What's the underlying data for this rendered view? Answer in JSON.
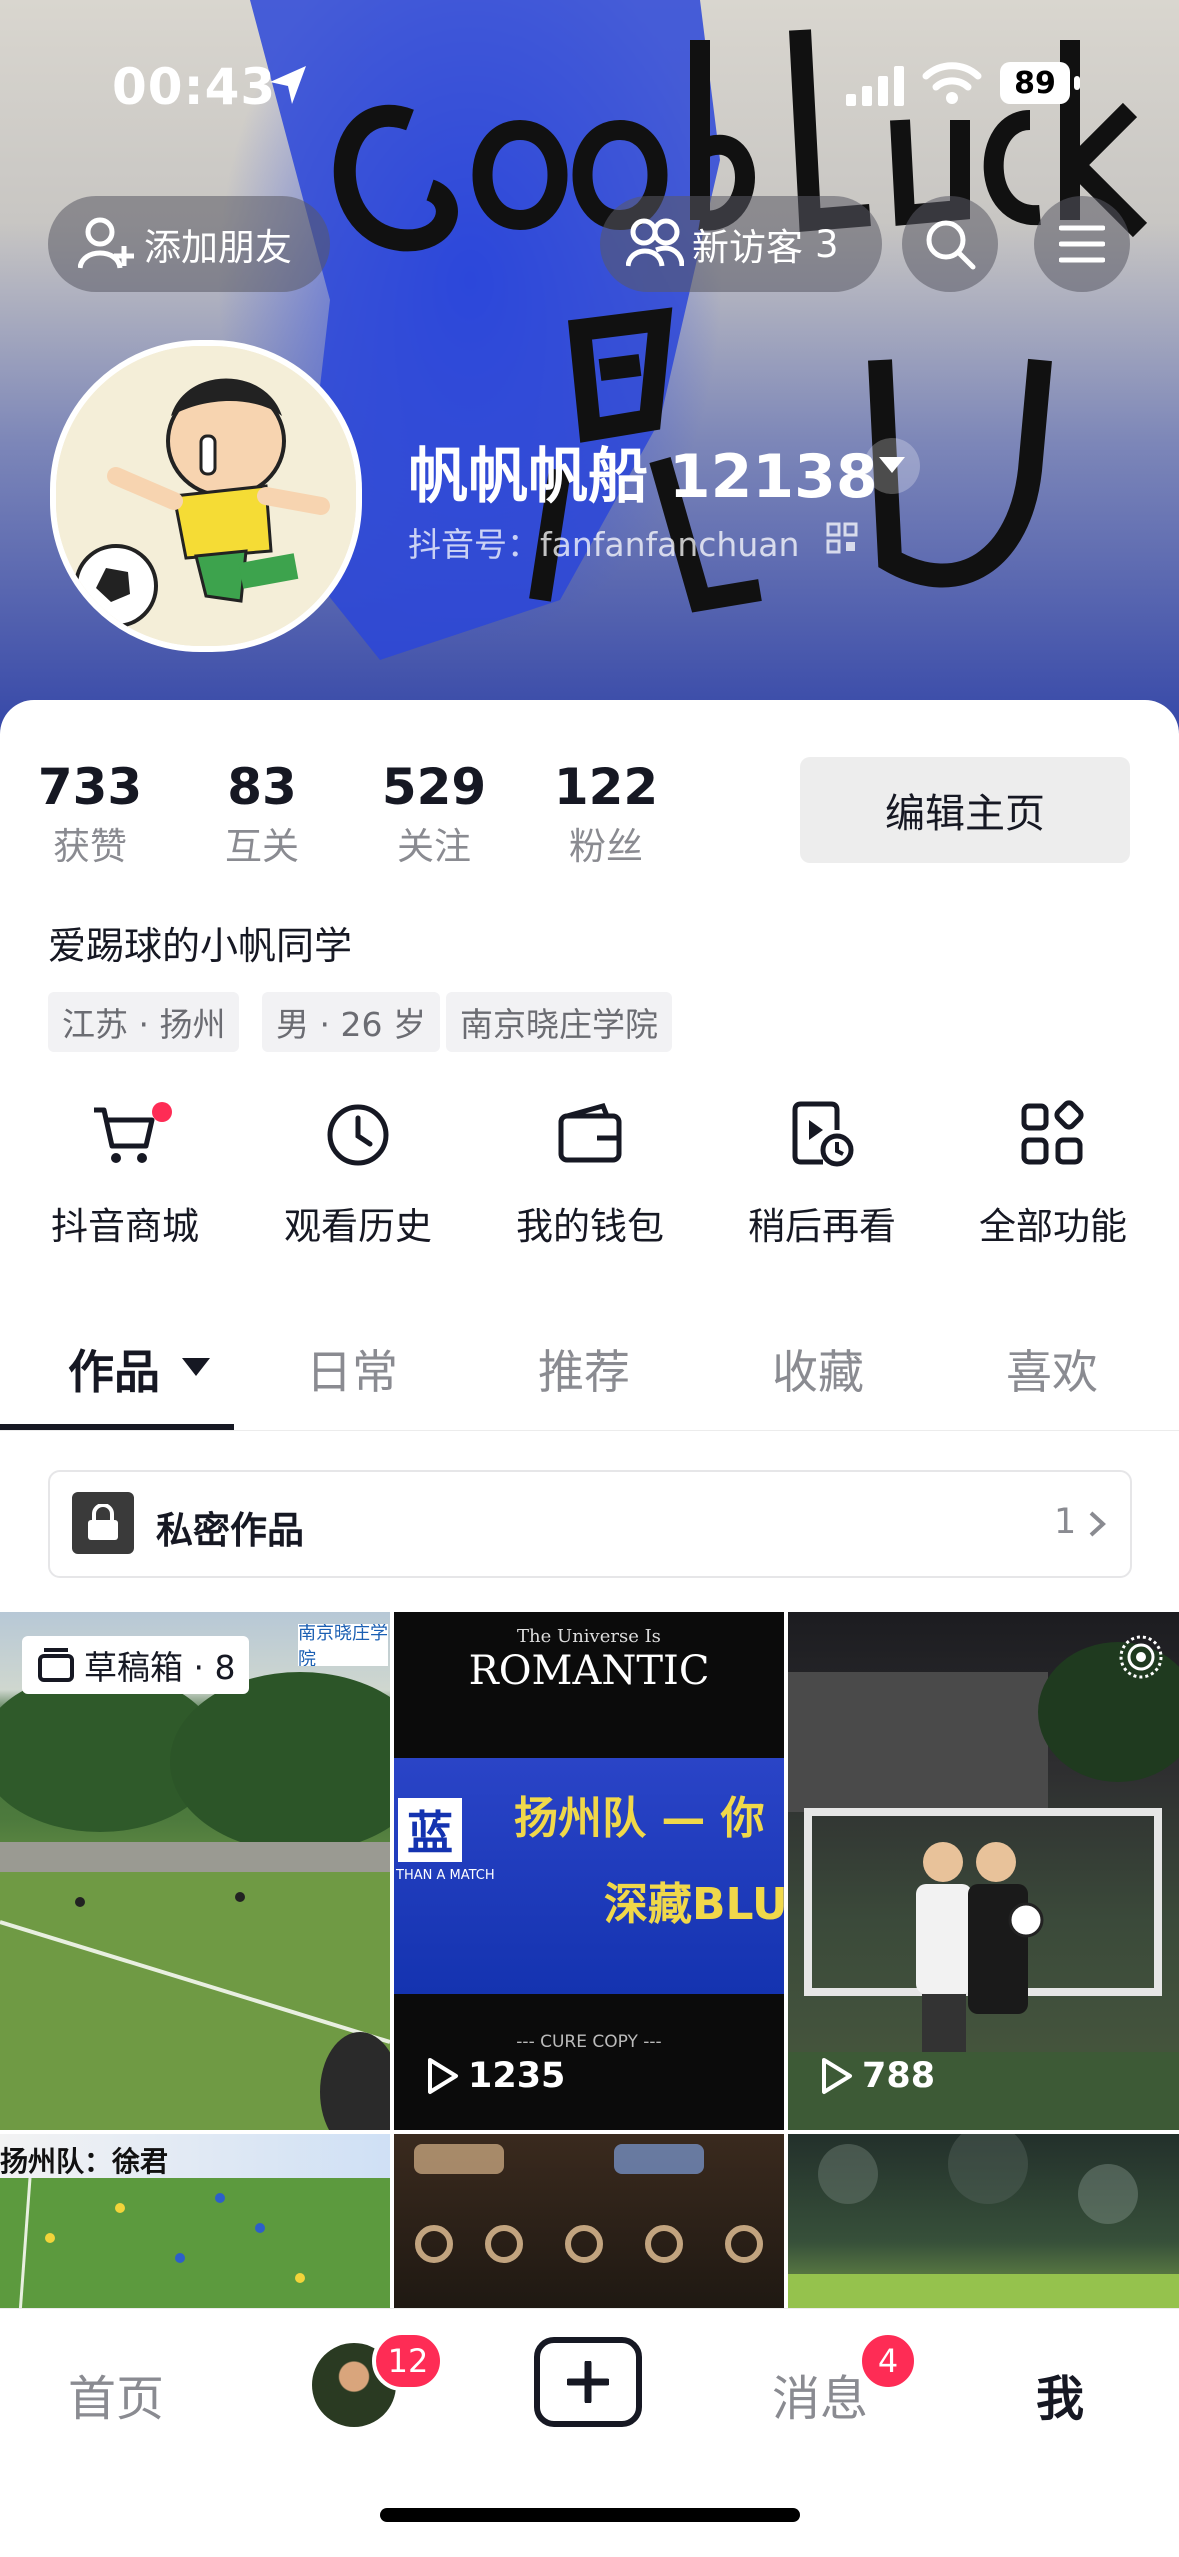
{
  "status_bar": {
    "time": "00:43",
    "battery": "89"
  },
  "header": {
    "add_friend_label": "添加朋友",
    "new_visitors_label": "新访客",
    "new_visitors_count": "3",
    "background_text": "Good Luck"
  },
  "profile": {
    "nickname": "帆帆帆船 12138",
    "douyin_id": "抖音号：fanfanfanchuan",
    "stats": [
      {
        "value": "733",
        "label": "获赞"
      },
      {
        "value": "83",
        "label": "互关"
      },
      {
        "value": "529",
        "label": "关注"
      },
      {
        "value": "122",
        "label": "粉丝"
      }
    ],
    "edit_button": "编辑主页",
    "bio": "爱踢球的小帆同学",
    "tags": [
      "江苏 · 扬州",
      "男 · 26 岁",
      "南京晓庄学院"
    ]
  },
  "functions": [
    {
      "label": "抖音商城",
      "icon": "cart-icon",
      "has_dot": true
    },
    {
      "label": "观看历史",
      "icon": "clock-icon"
    },
    {
      "label": "我的钱包",
      "icon": "wallet-icon"
    },
    {
      "label": "稍后再看",
      "icon": "watch-later-icon"
    },
    {
      "label": "全部功能",
      "icon": "grid-icon"
    }
  ],
  "tabs": [
    "作品",
    "日常",
    "推荐",
    "收藏",
    "喜欢"
  ],
  "active_tab": "作品",
  "private_works": {
    "label": "私密作品",
    "count": "1"
  },
  "videos": [
    {
      "badge": "草稿箱 · 8",
      "overlay_text": "南京晓庄学院"
    },
    {
      "title_top": "The Universe Is",
      "title": "ROMANTIC",
      "banner": "扬州队 — 你",
      "banner2": "深藏BLU",
      "banner_side": "蓝",
      "banner_side_sub": "THAN A MATCH",
      "footer": "--- CURE COPY ---",
      "plays": "1235"
    },
    {
      "plays": "788"
    },
    {
      "caption": "扬州队：徐君"
    },
    {},
    {}
  ],
  "bottom_nav": {
    "home": "首页",
    "friends_badge": "12",
    "messages": "消息",
    "messages_badge": "4",
    "me": "我"
  }
}
